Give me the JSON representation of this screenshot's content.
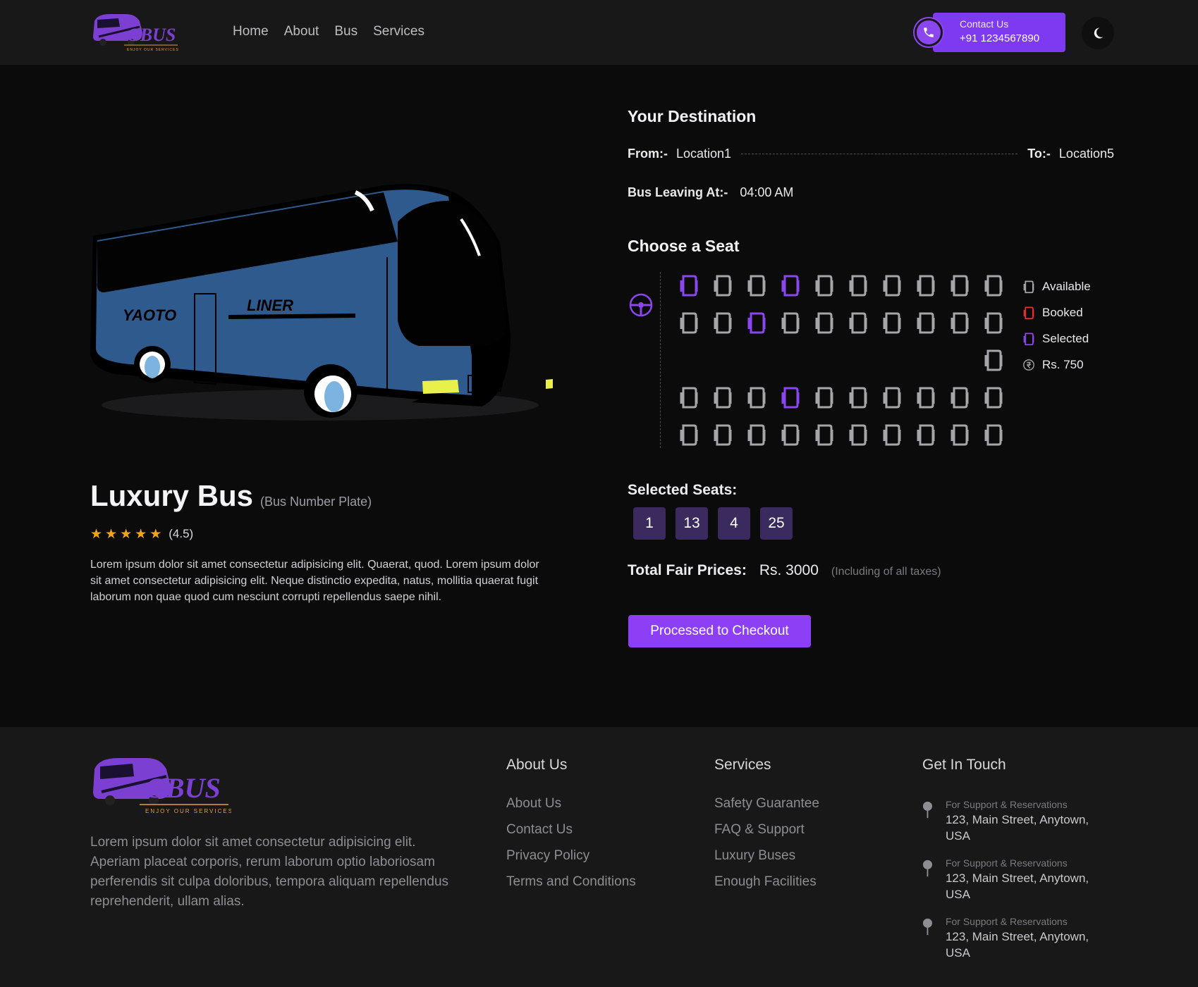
{
  "header": {
    "logo_text": "GBUS",
    "logo_tagline": "ENJOY OUR SERVICES",
    "nav": [
      "Home",
      "About",
      "Bus",
      "Services"
    ],
    "contact_label": "Contact Us",
    "contact_phone": "+91 1234567890",
    "theme_icon": "moon-icon"
  },
  "bus": {
    "art_side_text_1": "YAOTO",
    "art_side_text_2": "LINER",
    "name": "Luxury Bus",
    "plate": "(Bus Number Plate)",
    "rating": "(4.5)",
    "stars": 5,
    "description": "Lorem ipsum dolor sit amet consectetur adipisicing elit. Quaerat, quod. Lorem ipsum dolor sit amet consectetur adipisicing elit. Neque distinctio expedita, natus, mollitia quaerat fugit laborum non quae quod cum nesciunt corrupti repellendus saepe nihil."
  },
  "destination": {
    "heading": "Your Destination",
    "from_label": "From:-",
    "from": "Location1",
    "to_label": "To:-",
    "to": "Location5",
    "leaving_label": "Bus Leaving At:-",
    "leaving_time": "04:00 AM"
  },
  "seats": {
    "heading": "Choose a Seat",
    "selected_seats": [
      1,
      4,
      13,
      25
    ],
    "layout": [
      [
        "selected",
        "available",
        "available",
        "selected",
        "available",
        "available",
        "available",
        "available",
        "available",
        "available"
      ],
      [
        "available",
        "available",
        "selected",
        "available",
        "available",
        "available",
        "available",
        "available",
        "available",
        "available"
      ],
      [
        "",
        "",
        "",
        "",
        "",
        "",
        "",
        "",
        "",
        "available"
      ],
      [
        "available",
        "available",
        "available",
        "selected",
        "available",
        "available",
        "available",
        "available",
        "available",
        "available"
      ],
      [
        "available",
        "available",
        "available",
        "available",
        "available",
        "available",
        "available",
        "available",
        "available",
        "available"
      ]
    ],
    "legend": {
      "available": "Available",
      "booked": "Booked",
      "selected": "Selected",
      "price": "Rs. 750"
    },
    "colors": {
      "available": "#a5a5aa",
      "booked": "#e0342c",
      "selected": "#8b46f0"
    }
  },
  "summary": {
    "selected_heading": "Selected Seats:",
    "chips": [
      "1",
      "13",
      "4",
      "25"
    ],
    "total_label": "Total Fair Prices:",
    "total_value": "Rs. 3000",
    "total_note": "(Including of all taxes)",
    "checkout_label": "Processed to Checkout"
  },
  "footer": {
    "about_text": "Lorem ipsum dolor sit amet consectetur adipisicing elit. Aperiam placeat corporis, rerum laborum optio laboriosam perferendis sit culpa doloribus, tempora aliquam repellendus reprehenderit, ullam alias.",
    "about_heading": "About Us",
    "about_links": [
      "About Us",
      "Contact Us",
      "Privacy Policy",
      "Terms and Conditions"
    ],
    "services_heading": "Services",
    "services_links": [
      "Safety Guarantee",
      "FAQ & Support",
      "Luxury Buses",
      "Enough Facilities"
    ],
    "touch_heading": "Get In Touch",
    "touch_items": [
      {
        "label": "For Support & Reservations",
        "address": "123, Main Street, Anytown, USA"
      },
      {
        "label": "For Support & Reservations",
        "address": "123, Main Street, Anytown, USA"
      },
      {
        "label": "For Support & Reservations",
        "address": "123, Main Street, Anytown, USA"
      }
    ]
  },
  "colors": {
    "accent": "#8d3ff5",
    "background": "#0b0b0c",
    "header": "#181818",
    "star": "#f0a41b"
  }
}
